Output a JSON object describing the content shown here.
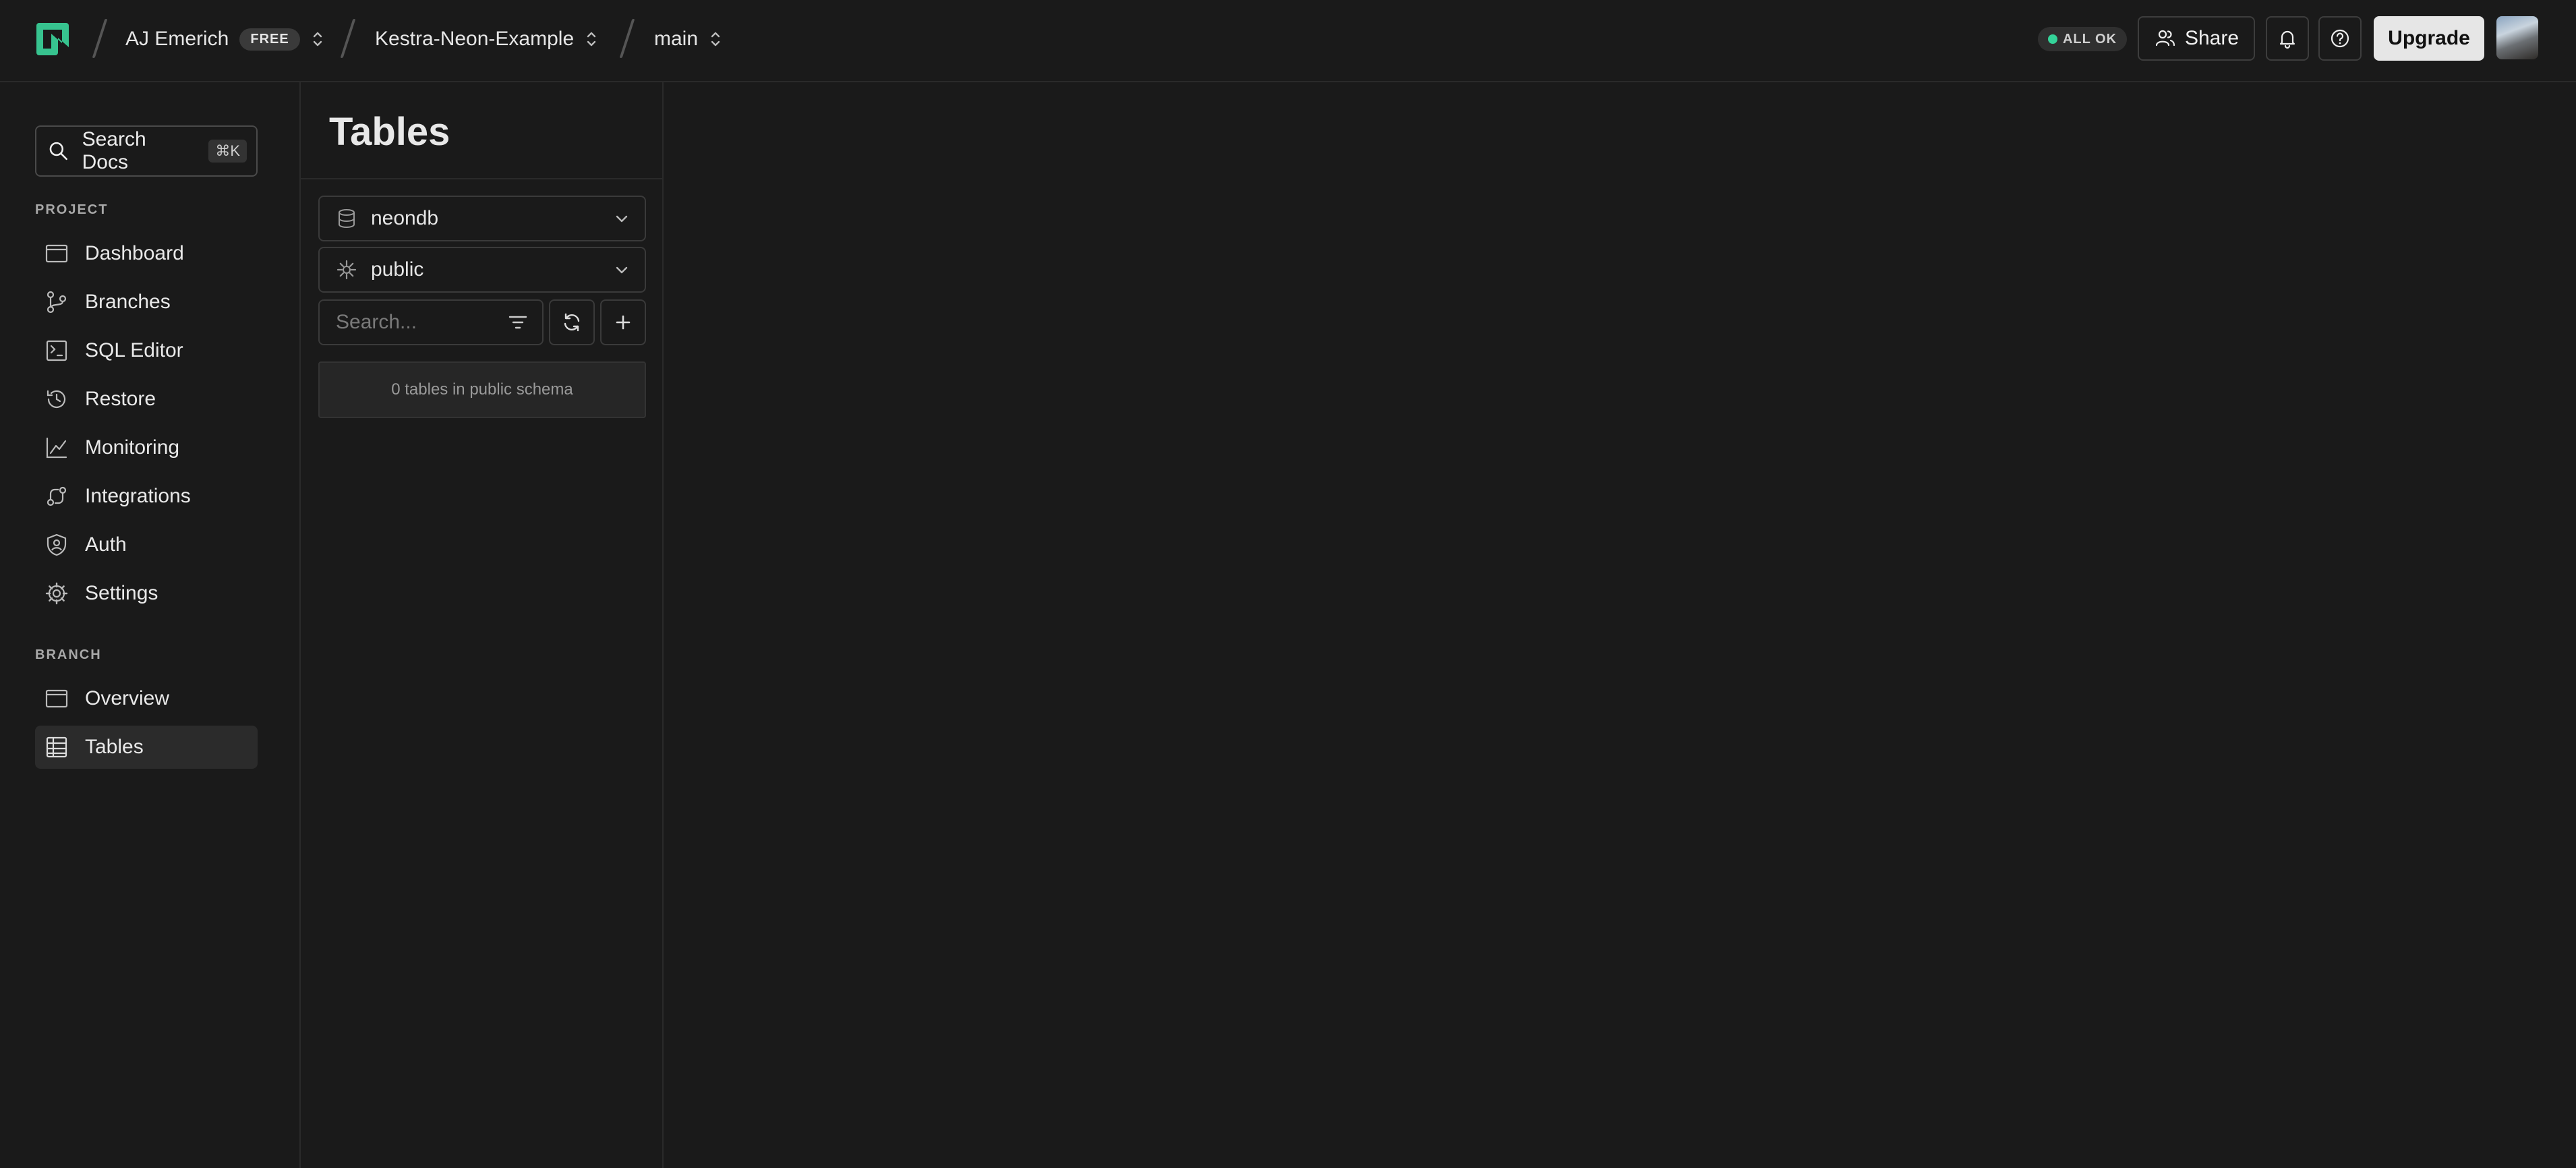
{
  "topbar": {
    "org_name": "AJ Emerich",
    "plan_badge": "FREE",
    "project_name": "Kestra-Neon-Example",
    "branch_name": "main",
    "status_text": "ALL OK",
    "status_color": "#34d399",
    "share_label": "Share",
    "upgrade_label": "Upgrade",
    "icons": [
      "neon-logo-icon",
      "bell-icon",
      "help-icon",
      "users-icon"
    ]
  },
  "sidebar": {
    "search_label": "Search Docs",
    "search_shortcut": "⌘K",
    "project_section": "PROJECT",
    "project_items": [
      {
        "label": "Dashboard",
        "icon": "dashboard-icon"
      },
      {
        "label": "Branches",
        "icon": "branches-icon"
      },
      {
        "label": "SQL Editor",
        "icon": "sql-editor-icon"
      },
      {
        "label": "Restore",
        "icon": "restore-icon"
      },
      {
        "label": "Monitoring",
        "icon": "monitoring-icon"
      },
      {
        "label": "Integrations",
        "icon": "integrations-icon"
      },
      {
        "label": "Auth",
        "icon": "auth-icon"
      },
      {
        "label": "Settings",
        "icon": "gear-icon"
      }
    ],
    "branch_section": "BRANCH",
    "branch_items": [
      {
        "label": "Overview",
        "icon": "overview-icon"
      },
      {
        "label": "Tables",
        "icon": "tables-icon",
        "active": true
      }
    ]
  },
  "tables_panel": {
    "title": "Tables",
    "database_select": "neondb",
    "schema_select": "public",
    "search_placeholder": "Search...",
    "empty_message": "0 tables in public schema"
  }
}
